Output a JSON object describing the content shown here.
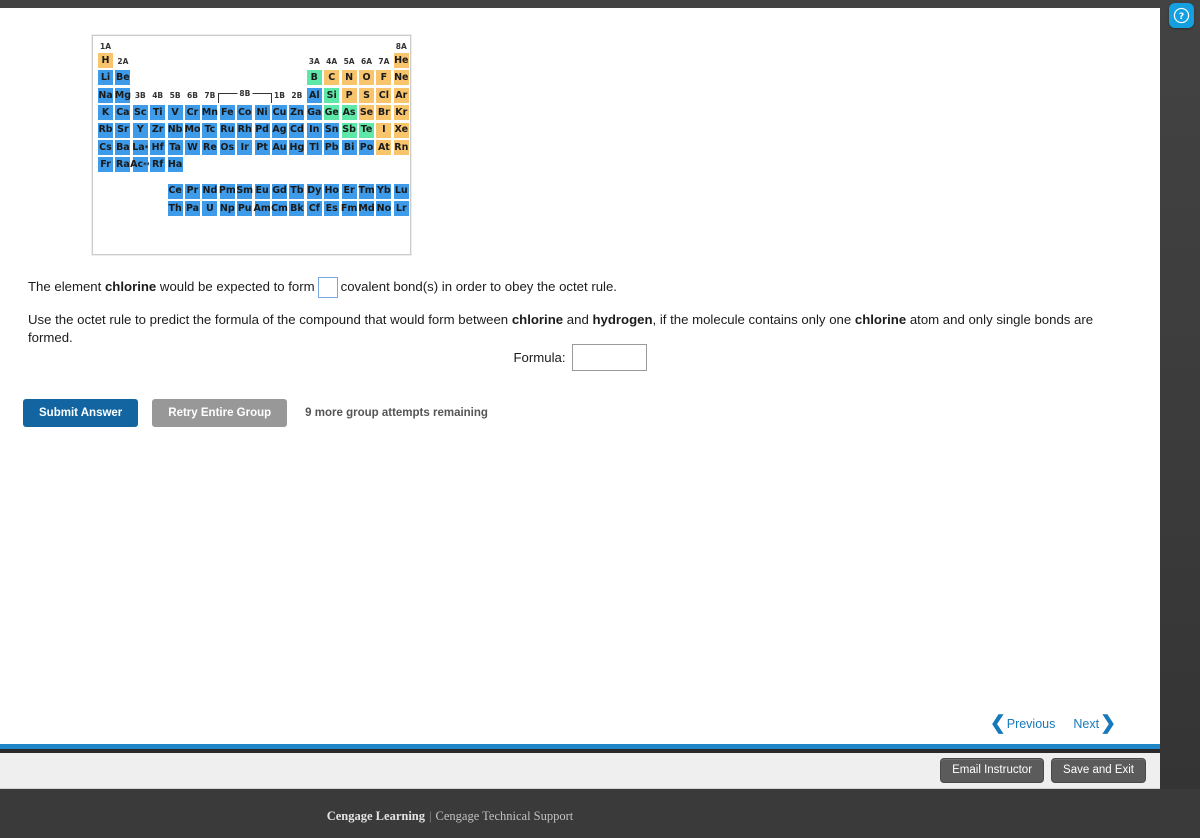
{
  "window": {
    "top_clipped_text": "",
    "help_icon": "help-circle-icon"
  },
  "periodic_table": {
    "group_labels": [
      "1A",
      "2A",
      "3B",
      "4B",
      "5B",
      "6B",
      "7B",
      "8B",
      "1B",
      "2B",
      "3A",
      "4A",
      "5A",
      "6A",
      "7A",
      "8A"
    ],
    "legend_colors": {
      "metal": "#3d9be9",
      "nonmetal": "#f8c46c",
      "metalloid": "#5ee8a8"
    },
    "rows": [
      [
        {
          "s": "H",
          "t": "nonmetal"
        },
        {
          "s": "He",
          "t": "nonmetal"
        }
      ],
      [
        {
          "s": "Li",
          "t": "metal"
        },
        {
          "s": "Be",
          "t": "metal"
        },
        {
          "s": "B",
          "t": "metalloid"
        },
        {
          "s": "C",
          "t": "nonmetal"
        },
        {
          "s": "N",
          "t": "nonmetal"
        },
        {
          "s": "O",
          "t": "nonmetal"
        },
        {
          "s": "F",
          "t": "nonmetal"
        },
        {
          "s": "Ne",
          "t": "nonmetal"
        }
      ],
      [
        {
          "s": "Na",
          "t": "metal"
        },
        {
          "s": "Mg",
          "t": "metal"
        },
        {
          "s": "Al",
          "t": "metal"
        },
        {
          "s": "Si",
          "t": "metalloid"
        },
        {
          "s": "P",
          "t": "nonmetal"
        },
        {
          "s": "S",
          "t": "nonmetal"
        },
        {
          "s": "Cl",
          "t": "nonmetal"
        },
        {
          "s": "Ar",
          "t": "nonmetal"
        }
      ],
      [
        {
          "s": "K",
          "t": "metal"
        },
        {
          "s": "Ca",
          "t": "metal"
        },
        {
          "s": "Sc",
          "t": "metal"
        },
        {
          "s": "Ti",
          "t": "metal"
        },
        {
          "s": "V",
          "t": "metal"
        },
        {
          "s": "Cr",
          "t": "metal"
        },
        {
          "s": "Mn",
          "t": "metal"
        },
        {
          "s": "Fe",
          "t": "metal"
        },
        {
          "s": "Co",
          "t": "metal"
        },
        {
          "s": "Ni",
          "t": "metal"
        },
        {
          "s": "Cu",
          "t": "metal"
        },
        {
          "s": "Zn",
          "t": "metal"
        },
        {
          "s": "Ga",
          "t": "metal"
        },
        {
          "s": "Ge",
          "t": "metalloid"
        },
        {
          "s": "As",
          "t": "metalloid"
        },
        {
          "s": "Se",
          "t": "nonmetal"
        },
        {
          "s": "Br",
          "t": "nonmetal"
        },
        {
          "s": "Kr",
          "t": "nonmetal"
        }
      ],
      [
        {
          "s": "Rb",
          "t": "metal"
        },
        {
          "s": "Sr",
          "t": "metal"
        },
        {
          "s": "Y",
          "t": "metal"
        },
        {
          "s": "Zr",
          "t": "metal"
        },
        {
          "s": "Nb",
          "t": "metal"
        },
        {
          "s": "Mo",
          "t": "metal"
        },
        {
          "s": "Tc",
          "t": "metal"
        },
        {
          "s": "Ru",
          "t": "metal"
        },
        {
          "s": "Rh",
          "t": "metal"
        },
        {
          "s": "Pd",
          "t": "metal"
        },
        {
          "s": "Ag",
          "t": "metal"
        },
        {
          "s": "Cd",
          "t": "metal"
        },
        {
          "s": "In",
          "t": "metal"
        },
        {
          "s": "Sn",
          "t": "metal"
        },
        {
          "s": "Sb",
          "t": "metalloid"
        },
        {
          "s": "Te",
          "t": "metalloid"
        },
        {
          "s": "I",
          "t": "nonmetal"
        },
        {
          "s": "Xe",
          "t": "nonmetal"
        }
      ],
      [
        {
          "s": "Cs",
          "t": "metal"
        },
        {
          "s": "Ba",
          "t": "metal"
        },
        {
          "s": "La",
          "t": "metal",
          "mark": "*"
        },
        {
          "s": "Hf",
          "t": "metal"
        },
        {
          "s": "Ta",
          "t": "metal"
        },
        {
          "s": "W",
          "t": "metal"
        },
        {
          "s": "Re",
          "t": "metal"
        },
        {
          "s": "Os",
          "t": "metal"
        },
        {
          "s": "Ir",
          "t": "metal"
        },
        {
          "s": "Pt",
          "t": "metal"
        },
        {
          "s": "Au",
          "t": "metal"
        },
        {
          "s": "Hg",
          "t": "metal"
        },
        {
          "s": "Tl",
          "t": "metal"
        },
        {
          "s": "Pb",
          "t": "metal"
        },
        {
          "s": "Bi",
          "t": "metal"
        },
        {
          "s": "Po",
          "t": "metal"
        },
        {
          "s": "At",
          "t": "nonmetal"
        },
        {
          "s": "Rn",
          "t": "nonmetal"
        }
      ],
      [
        {
          "s": "Fr",
          "t": "metal"
        },
        {
          "s": "Ra",
          "t": "metal"
        },
        {
          "s": "Ac",
          "t": "metal",
          "mark": "**"
        },
        {
          "s": "Rf",
          "t": "metal"
        },
        {
          "s": "Ha",
          "t": "metal"
        }
      ]
    ],
    "lanthanides": [
      "Ce",
      "Pr",
      "Nd",
      "Pm",
      "Sm",
      "Eu",
      "Gd",
      "Tb",
      "Dy",
      "Ho",
      "Er",
      "Tm",
      "Yb",
      "Lu"
    ],
    "actinides": [
      "Th",
      "Pa",
      "U",
      "Np",
      "Pu",
      "Am",
      "Cm",
      "Bk",
      "Cf",
      "Es",
      "Fm",
      "Md",
      "No",
      "Lr"
    ]
  },
  "question1": {
    "part1": "The element ",
    "element": "chlorine",
    "part2": " would be expected to form",
    "part3": "covalent bond(s) in order to obey the octet rule.",
    "blank_value": ""
  },
  "question2": {
    "part1": "Use the octet rule to predict the formula of the compound that would form between ",
    "element1": "chlorine",
    "part2": " and ",
    "element2": "hydrogen",
    "part3": ", if the molecule contains only one ",
    "element3": "chlorine",
    "part4": " atom and only single bonds are formed."
  },
  "formula": {
    "label": "Formula:",
    "value": "",
    "placeholder": ""
  },
  "actions": {
    "submit_label": "Submit Answer",
    "retry_label": "Retry Entire Group",
    "attempts_text": "9 more group attempts remaining"
  },
  "pager": {
    "previous_label": "Previous",
    "next_label": "Next",
    "prev_icon": "chevron-left-icon",
    "next_icon": "chevron-right-icon"
  },
  "toolbar": {
    "email_instructor_label": "Email Instructor",
    "save_exit_label": "Save and Exit"
  },
  "footer": {
    "brand": "Cengage Learning",
    "separator": "|",
    "support": "Cengage Technical Support"
  }
}
